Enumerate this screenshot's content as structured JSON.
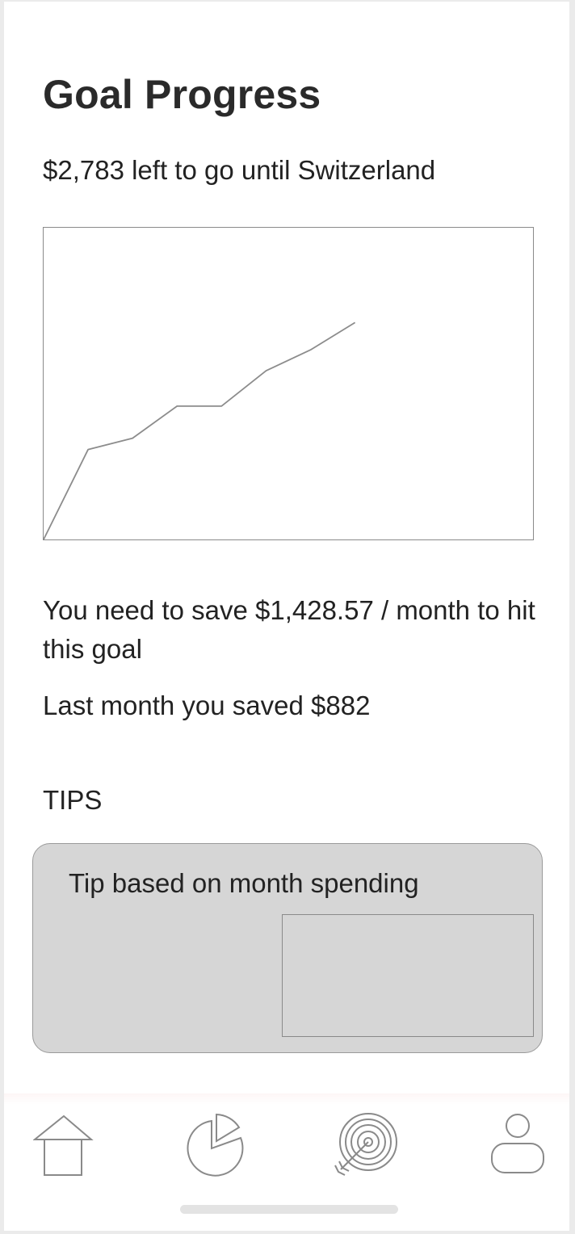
{
  "header": {
    "title": "Goal Progress",
    "subtitle": "$2,783 left to go until Switzerland"
  },
  "chart_data": {
    "type": "line",
    "title": "",
    "xlabel": "",
    "ylabel": "",
    "grid": false,
    "x": [
      0,
      1,
      2,
      3,
      4,
      5,
      6,
      7
    ],
    "series": [
      {
        "values": [
          0,
          112,
          126,
          166,
          166,
          210,
          236,
          270
        ]
      }
    ],
    "xlim": [
      0,
      11
    ],
    "ylim": [
      0,
      388
    ],
    "line_color": "#8c8c8c"
  },
  "savings": {
    "need_text": "You need to save $1,428.57 / month to hit this goal",
    "last_month_text": "Last month you saved $882"
  },
  "tips": {
    "section_label": "TIPS",
    "card_title": "Tip based on month spending"
  },
  "tab_bar": {
    "tabs": [
      {
        "icon": "home-icon"
      },
      {
        "icon": "pie-chart-icon"
      },
      {
        "icon": "target-icon"
      },
      {
        "icon": "profile-icon"
      }
    ]
  },
  "colors": {
    "background": "#ffffff",
    "card": "#d6d6d6",
    "stroke": "#8a8a8a",
    "text": "#222222"
  }
}
